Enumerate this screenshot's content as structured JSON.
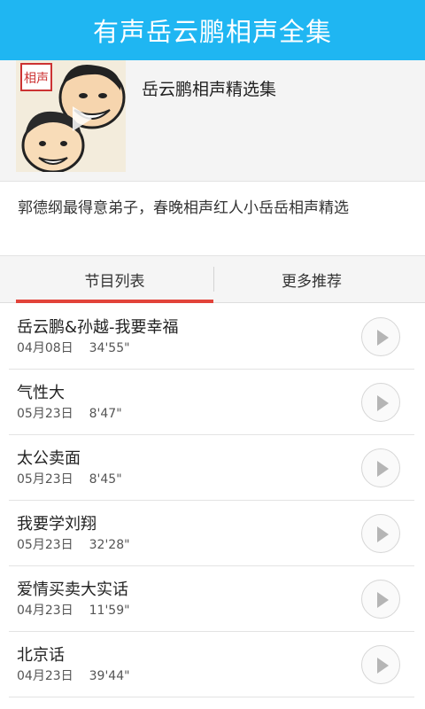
{
  "header": {
    "title": "有声岳云鹏相声全集"
  },
  "album": {
    "cover_icon": "comedian-caricature-cover",
    "cover_text": "相声",
    "name": "岳云鹏相声精选集",
    "description": "郭德纲最得意弟子，春晚相声红人小岳岳相声精选"
  },
  "tabs": [
    {
      "label": "节目列表",
      "active": true
    },
    {
      "label": "更多推荐",
      "active": false
    }
  ],
  "colors": {
    "header": "#1fb6f2",
    "tab_indicator": "#e2433a"
  },
  "programs": [
    {
      "title": "岳云鹏&孙越-我要幸福",
      "date": "04月08日",
      "duration": "34'55\""
    },
    {
      "title": "气性大",
      "date": "05月23日",
      "duration": "8'47\""
    },
    {
      "title": "太公卖面",
      "date": "05月23日",
      "duration": "8'45\""
    },
    {
      "title": "我要学刘翔",
      "date": "05月23日",
      "duration": "32'28\""
    },
    {
      "title": "爱情买卖大实话",
      "date": "04月23日",
      "duration": "11'59\""
    },
    {
      "title": "北京话",
      "date": "04月23日",
      "duration": "39'44\""
    }
  ]
}
